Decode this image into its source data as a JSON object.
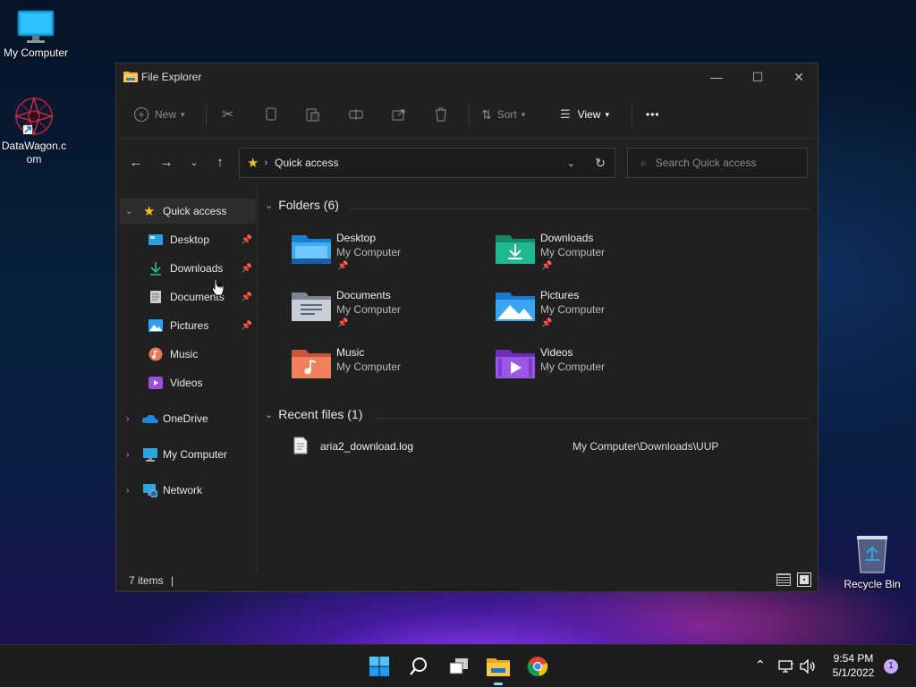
{
  "desktop": {
    "icons": [
      {
        "label": "My Computer"
      },
      {
        "label": "DataWagon.c om"
      },
      {
        "label": "Recycle Bin"
      }
    ]
  },
  "window": {
    "title": "File Explorer",
    "controls": {
      "minimize": "—",
      "maximize": "☐",
      "close": "✕"
    }
  },
  "toolbar": {
    "new_label": "New",
    "sort_label": "Sort",
    "view_label": "View",
    "more_label": "•••"
  },
  "address": {
    "location": "Quick access",
    "search_placeholder": "Search Quick access"
  },
  "nav": {
    "quick_access": "Quick access",
    "pinned": [
      {
        "label": "Desktop",
        "pinned": true
      },
      {
        "label": "Downloads",
        "pinned": true
      },
      {
        "label": "Documents",
        "pinned": true
      },
      {
        "label": "Pictures",
        "pinned": true
      },
      {
        "label": "Music",
        "pinned": false
      },
      {
        "label": "Videos",
        "pinned": false
      }
    ],
    "roots": [
      {
        "label": "OneDrive"
      },
      {
        "label": "My Computer"
      },
      {
        "label": "Network"
      }
    ]
  },
  "content": {
    "folders_header": "Folders (6)",
    "folders": [
      {
        "name": "Desktop",
        "location": "My Computer",
        "pinned": true
      },
      {
        "name": "Downloads",
        "location": "My Computer",
        "pinned": true
      },
      {
        "name": "Documents",
        "location": "My Computer",
        "pinned": true
      },
      {
        "name": "Pictures",
        "location": "My Computer",
        "pinned": true
      },
      {
        "name": "Music",
        "location": "My Computer",
        "pinned": false
      },
      {
        "name": "Videos",
        "location": "My Computer",
        "pinned": false
      }
    ],
    "recent_header": "Recent files (1)",
    "recent": [
      {
        "name": "aria2_download.log",
        "path": "My Computer\\Downloads\\UUP"
      }
    ]
  },
  "status": {
    "items": "7 items",
    "separator": "|"
  },
  "taskbar": {
    "time": "9:54 PM",
    "date": "5/1/2022",
    "notification_count": "1"
  }
}
